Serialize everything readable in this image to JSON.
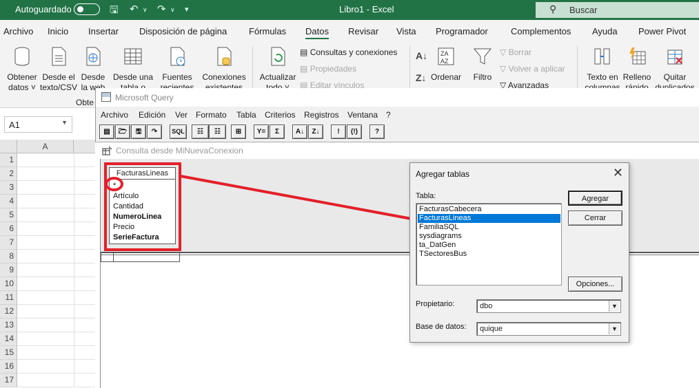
{
  "excel": {
    "autosave_label": "Autoguardado",
    "window_title": "Libro1  -  Excel",
    "search_placeholder": "Buscar",
    "tabs": [
      "Archivo",
      "Inicio",
      "Insertar",
      "Disposición de página",
      "Fórmulas",
      "Datos",
      "Revisar",
      "Vista",
      "Programador",
      "Complementos",
      "Ayuda",
      "Power Pivot"
    ],
    "active_tab": "Datos",
    "ribbon": {
      "obtener_line1": "Obtener",
      "obtener_line2": "datos",
      "desde_el_line1": "Desde el",
      "desde_el_line2": "texto/CSV",
      "desde_web_line1": "Desde",
      "desde_web_line2": "la web",
      "desde_tabla_line1": "Desde una",
      "desde_tabla_line2": "tabla o rango",
      "fuentes_line1": "Fuentes",
      "fuentes_line2": "recientes",
      "conexiones_line1": "Conexiones",
      "conexiones_line2": "existentes",
      "group_obtener": "Obte",
      "actualizar_line1": "Actualizar",
      "actualizar_line2": "todo",
      "consultas": "Consultas y conexiones",
      "propiedades": "Propiedades",
      "editar_vinculos": "Editar vínculos",
      "ordenar": "Ordenar",
      "filtro": "Filtro",
      "borrar": "Borrar",
      "volver_aplicar": "Volver a aplicar",
      "avanzadas": "Avanzadas",
      "texto_columnas_line1": "Texto en",
      "texto_columnas_line2": "columnas",
      "relleno_line1": "Relleno",
      "relleno_line2": "rápido",
      "quitar_line1": "Quitar",
      "quitar_line2": "duplicados"
    },
    "name_box": "A1",
    "column_a": "A",
    "rows": [
      "1",
      "2",
      "3",
      "4",
      "5",
      "6",
      "7",
      "8",
      "9",
      "10",
      "11",
      "12",
      "13",
      "14",
      "15",
      "16",
      "17"
    ]
  },
  "query": {
    "title": "Microsoft Query",
    "menu": [
      "Archivo",
      "Edición",
      "Ver",
      "Formato",
      "Tabla",
      "Criterios",
      "Registros",
      "Ventana",
      "?"
    ],
    "toolbar": [
      "new",
      "open",
      "save",
      "return",
      "SQL",
      "show-tables",
      "show-criteria",
      "add-tables",
      "criteria-equals",
      "sum",
      "sort-asc",
      "sort-desc",
      "query-now",
      "auto-query",
      "help"
    ],
    "child_title": "Consulta desde MiNuevaConexion",
    "table_box": {
      "name": "FacturasLineas",
      "star": "*",
      "fields": [
        "Artículo",
        "Cantidad",
        "NumeroLinea",
        "Precio",
        "SerieFactura"
      ],
      "bold_fields": [
        "NumeroLinea",
        "SerieFactura"
      ]
    },
    "annotation_color": "#e3202a"
  },
  "dialog": {
    "title": "Agregar tablas",
    "tabla_label": "Tabla:",
    "tables": [
      "FacturasCabecera",
      "FacturasLineas",
      "FamiliaSQL",
      "sysdiagrams",
      "ta_DatGen",
      "TSectoresBus"
    ],
    "selected_table": "FacturasLineas",
    "agregar_button": "Agregar",
    "cerrar_button": "Cerrar",
    "opciones_button": "Opciones...",
    "propietario_label": "Propietario:",
    "propietario_value": "dbo",
    "base_datos_label": "Base de datos:",
    "base_datos_value": "quique"
  },
  "colors": {
    "excel_green": "#217346",
    "selection_blue": "#0078d7"
  }
}
